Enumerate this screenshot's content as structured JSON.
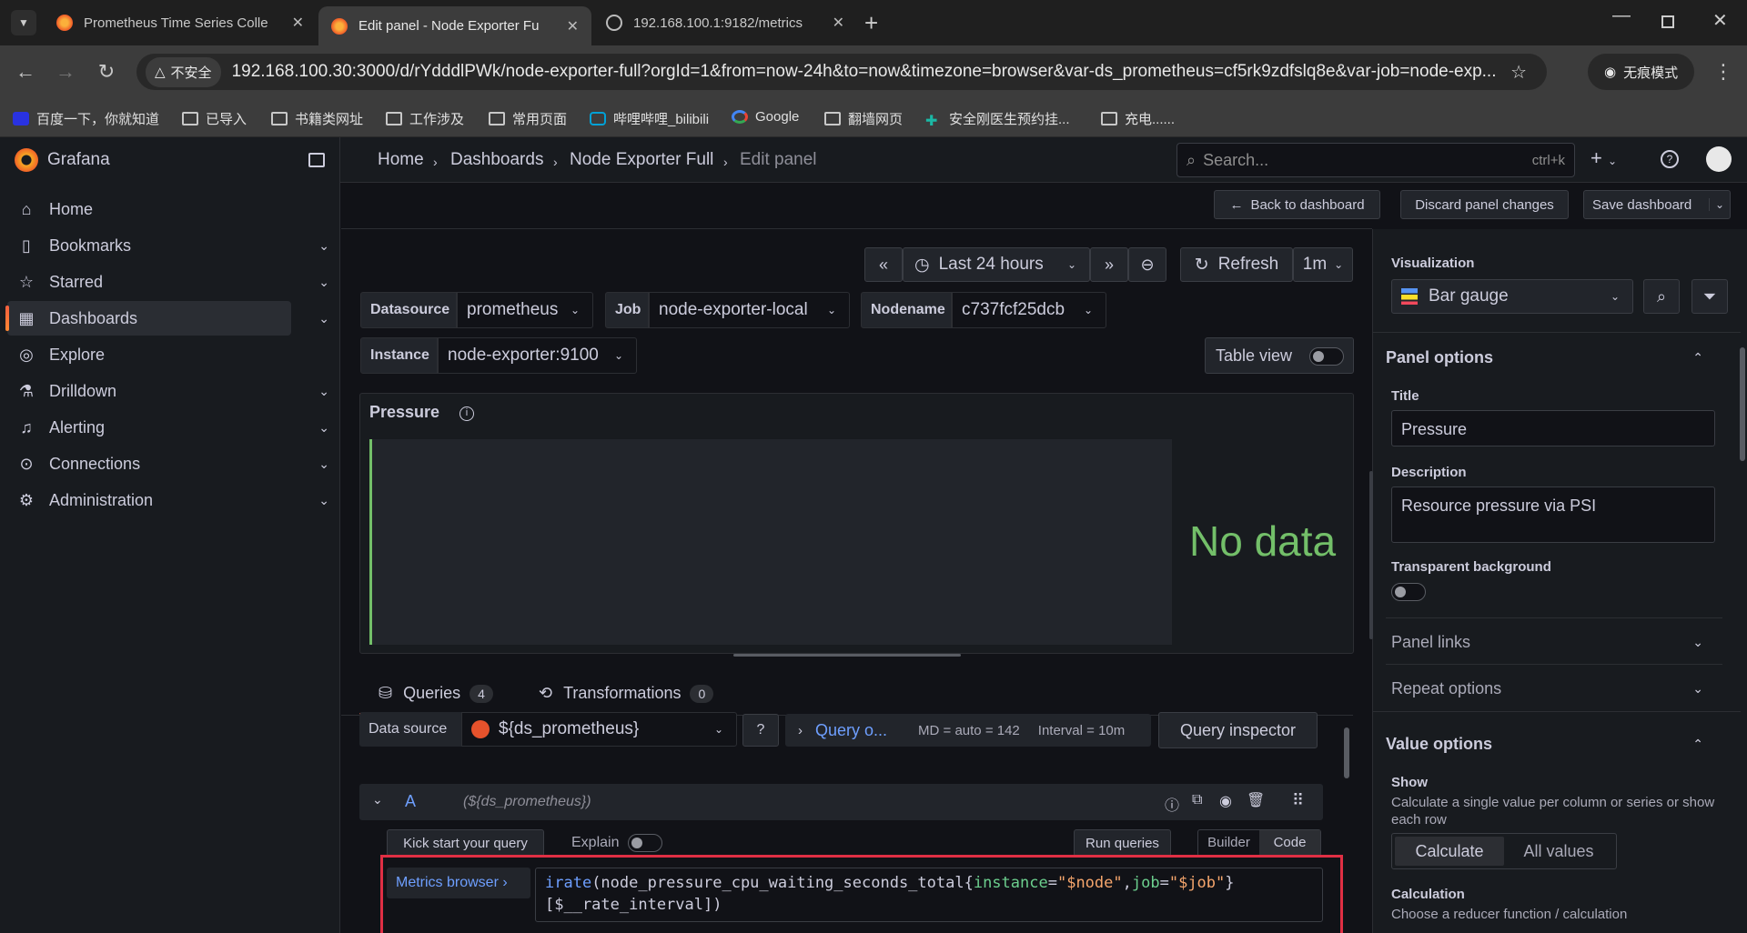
{
  "browser": {
    "tabs": [
      {
        "title": "Prometheus Time Series Colle",
        "icon": "grafana-favicon"
      },
      {
        "title": "Edit panel - Node Exporter Fu",
        "icon": "grafana-favicon"
      },
      {
        "title": "192.168.100.1:9182/metrics",
        "icon": "globe-favicon"
      }
    ],
    "insecure_label": "不安全",
    "url": "192.168.100.30:3000/d/rYdddlPWk/node-exporter-full?orgId=1&from=now-24h&to=now&timezone=browser&var-ds_prometheus=cf5rk9zdfslq8e&var-job=node-exp...",
    "incognito_label": "无痕模式",
    "bookmarks": [
      "百度一下，你就知道",
      "已导入",
      "书籍类网址",
      "工作涉及",
      "常用页面",
      "哔哩哔哩_bilibili",
      "Google",
      "翻墙网页",
      "安全刚医生预约挂...",
      "充电......"
    ]
  },
  "grafana": {
    "brand": "Grafana",
    "nav": [
      "Home",
      "Bookmarks",
      "Starred",
      "Dashboards",
      "Explore",
      "Drilldown",
      "Alerting",
      "Connections",
      "Administration"
    ],
    "breadcrumb": [
      "Home",
      "Dashboards",
      "Node Exporter Full",
      "Edit panel"
    ],
    "search_placeholder": "Search...",
    "search_shortcut": "ctrl+k",
    "back_to_dashboard": "Back to dashboard",
    "discard_changes": "Discard panel changes",
    "save_dashboard": "Save dashboard"
  },
  "timebar": {
    "range": "Last 24 hours",
    "refresh": "Refresh",
    "interval": "1m"
  },
  "variables": {
    "datasource_label": "Datasource",
    "datasource_value": "prometheus",
    "job_label": "Job",
    "job_value": "node-exporter-local",
    "nodename_label": "Nodename",
    "nodename_value": "c737fcf25dcb",
    "instance_label": "Instance",
    "instance_value": "node-exporter:9100",
    "table_view": "Table view"
  },
  "panel": {
    "title": "Pressure",
    "no_data": "No data"
  },
  "query_tabs": {
    "queries": "Queries",
    "queries_count": "4",
    "transformations": "Transformations",
    "transformations_count": "0"
  },
  "query_editor": {
    "datasource_label": "Data source",
    "datasource_value": "${ds_prometheus}",
    "query_options": "Query o...",
    "md": "MD = auto = 142",
    "interval": "Interval = 10m",
    "inspector": "Query inspector",
    "query_ref": "A",
    "query_ds": "(${ds_prometheus})",
    "kick_start": "Kick start your query",
    "explain": "Explain",
    "run_queries": "Run queries",
    "builder": "Builder",
    "code": "Code",
    "metrics_browser": "Metrics browser ›",
    "expr_fn": "irate",
    "expr_metric": "(node_pressure_cpu_waiting_seconds_total{",
    "expr_k1": "instance",
    "expr_v1": "\"$node\"",
    "expr_k2": "job",
    "expr_v2": "\"$job\"",
    "expr_close": "}",
    "expr_line2": "[$__rate_interval])"
  },
  "options": {
    "visualization_label": "Visualization",
    "visualization_value": "Bar gauge",
    "panel_options": "Panel options",
    "title_label": "Title",
    "title_value": "Pressure",
    "description_label": "Description",
    "description_value": "Resource pressure via PSI",
    "transparent_label": "Transparent background",
    "panel_links": "Panel links",
    "repeat_options": "Repeat options",
    "value_options": "Value options",
    "show_label": "Show",
    "show_desc": "Calculate a single value per column or series or show each row",
    "calculate": "Calculate",
    "all_values": "All values",
    "calculation_label": "Calculation",
    "calculation_desc": "Choose a reducer function / calculation"
  }
}
